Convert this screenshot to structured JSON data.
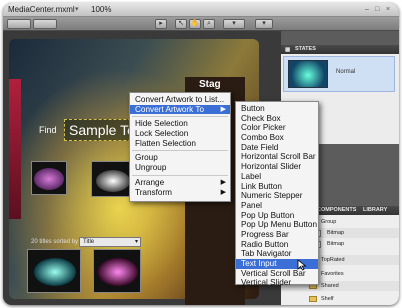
{
  "window": {
    "title": "MediaCenter.mxml",
    "zoom": "100%",
    "controls": [
      "minimize-icon",
      "maximize-icon",
      "close-icon"
    ]
  },
  "artboard": {
    "find_label": "Find",
    "search_text": "Sample Text",
    "stage_label": "Stag",
    "sort_label": "20 titles sorted by",
    "sort_value": "Title"
  },
  "context_menu": {
    "items": [
      {
        "label": "Convert Artwork to List..."
      },
      {
        "label": "Convert Artwork To",
        "submenu": true,
        "highlighted": true
      },
      {
        "separator": true
      },
      {
        "label": "Hide Selection"
      },
      {
        "label": "Lock Selection"
      },
      {
        "label": "Flatten Selection"
      },
      {
        "separator": true
      },
      {
        "label": "Group"
      },
      {
        "label": "Ungroup"
      },
      {
        "separator": true
      },
      {
        "label": "Arrange",
        "submenu": true
      },
      {
        "label": "Transform",
        "submenu": true
      }
    ]
  },
  "submenu": {
    "items": [
      "Button",
      "Check Box",
      "Color Picker",
      "Combo Box",
      "Date Field",
      "Horizontal Scroll Bar",
      "Horizontal Slider",
      "Label",
      "Link Button",
      "Numeric Stepper",
      "Panel",
      "Pop Up Button",
      "Pop Up Menu Button",
      "Progress Bar",
      "Radio Button",
      "Tab Navigator",
      "Text Input",
      "Vertical Scroll Bar",
      "Vertical Slider"
    ],
    "highlighted": "Text Input"
  },
  "states_panel": {
    "header": "STATES",
    "state_name": "Normal"
  },
  "components_panel": {
    "tabs": [
      "COMPONENTS",
      "LIBRARY"
    ],
    "rows": [
      {
        "label": "Group",
        "type": "folder"
      },
      {
        "label": "Bitmap",
        "type": "file"
      },
      {
        "label": "Bitmap",
        "type": "file"
      },
      {
        "label": "TopRated",
        "type": "folder"
      },
      {
        "label": "Favorites",
        "type": "folder"
      },
      {
        "label": "Shared",
        "type": "folder"
      },
      {
        "label": "Shelf",
        "type": "folder"
      }
    ]
  },
  "colors": {
    "menu_highlight": "#3b6fd6",
    "search_border": "#d6c24a"
  }
}
